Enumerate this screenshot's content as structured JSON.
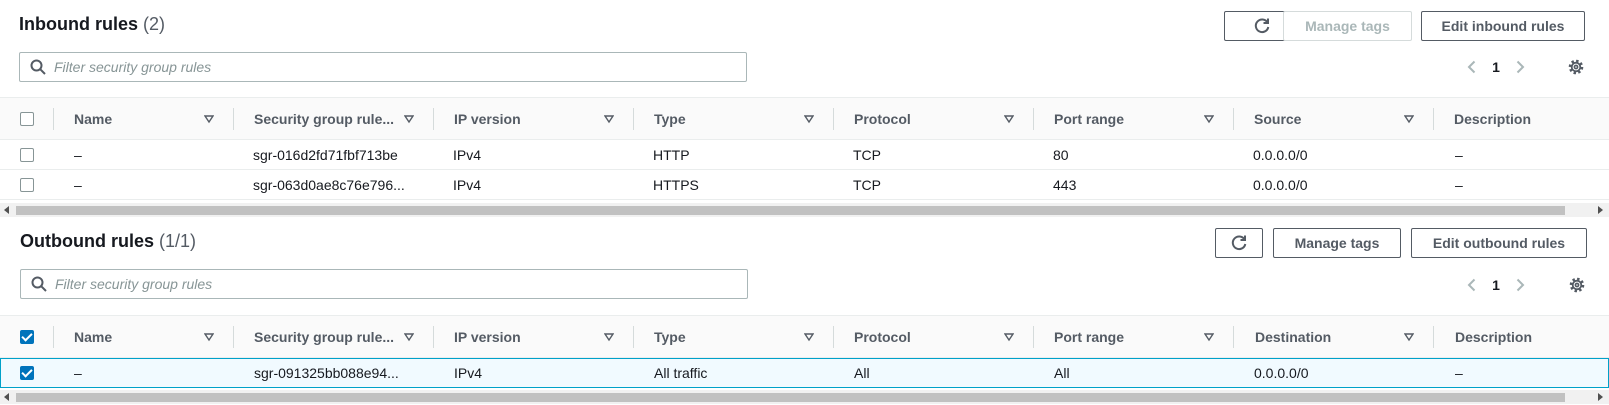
{
  "inbound": {
    "title": "Inbound rules",
    "count": "(2)",
    "manage_tags_label": "Manage tags",
    "edit_label": "Edit inbound rules",
    "search_placeholder": "Filter security group rules",
    "page_number": "1",
    "columns": [
      "Name",
      "Security group rule...",
      "IP version",
      "Type",
      "Protocol",
      "Port range",
      "Source",
      "Description"
    ],
    "rows": [
      {
        "name": "–",
        "rule_id": "sgr-016d2fd71fbf713be",
        "ip_version": "IPv4",
        "type": "HTTP",
        "protocol": "TCP",
        "port_range": "80",
        "source": "0.0.0.0/0",
        "description": "–"
      },
      {
        "name": "–",
        "rule_id": "sgr-063d0ae8c76e796...",
        "ip_version": "IPv4",
        "type": "HTTPS",
        "protocol": "TCP",
        "port_range": "443",
        "source": "0.0.0.0/0",
        "description": "–"
      }
    ]
  },
  "outbound": {
    "title": "Outbound rules",
    "count": "(1/1)",
    "manage_tags_label": "Manage tags",
    "edit_label": "Edit outbound rules",
    "search_placeholder": "Filter security group rules",
    "page_number": "1",
    "columns": [
      "Name",
      "Security group rule...",
      "IP version",
      "Type",
      "Protocol",
      "Port range",
      "Destination",
      "Description"
    ],
    "rows": [
      {
        "name": "–",
        "rule_id": "sgr-091325bb088e94...",
        "ip_version": "IPv4",
        "type": "All traffic",
        "protocol": "All",
        "port_range": "All",
        "destination": "0.0.0.0/0",
        "description": "–",
        "selected": true
      }
    ]
  },
  "icons": {
    "refresh": "refresh-icon",
    "search": "search-icon",
    "prev": "chevron-left-icon",
    "next": "chevron-right-icon",
    "settings": "gear-icon",
    "sort": "sort-caret-icon"
  },
  "colors": {
    "selection_blue": "#0073bb",
    "selected_row_bg": "#f1faff",
    "selected_row_border": "#00a1c9"
  }
}
